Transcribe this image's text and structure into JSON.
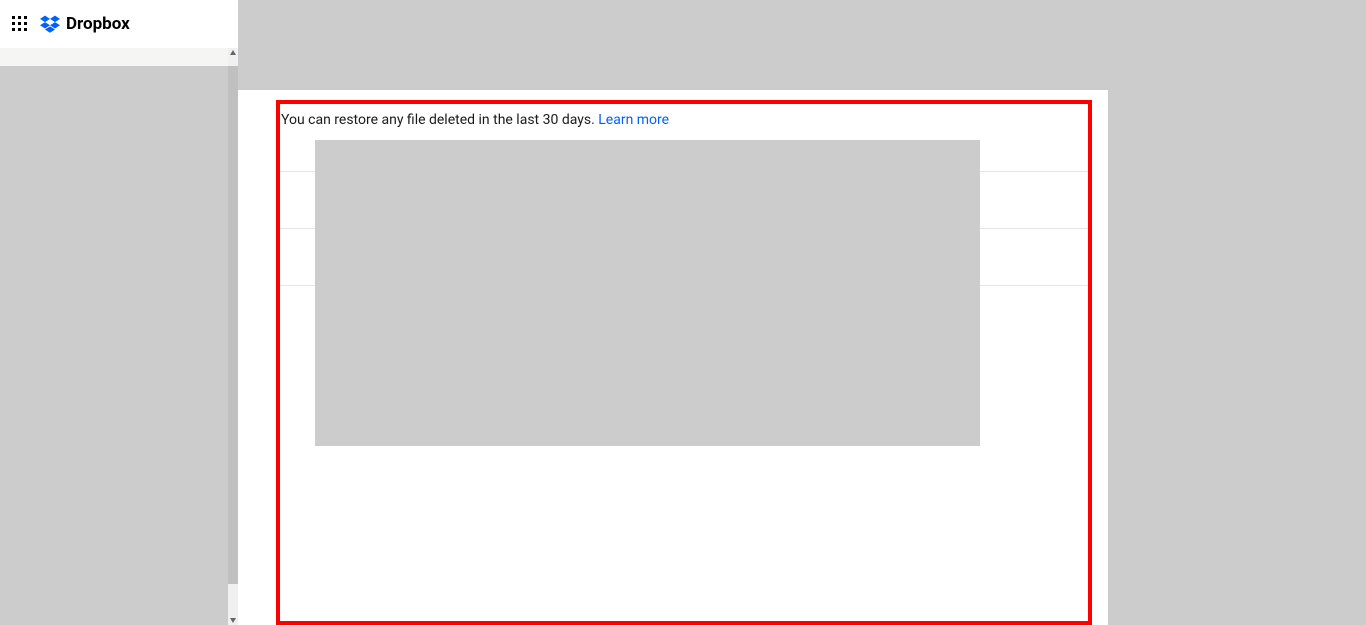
{
  "header": {
    "brand_name": "Dropbox"
  },
  "main": {
    "restore_text": "You can restore any file deleted in the last 30 days. ",
    "learn_more_label": "Learn more"
  }
}
